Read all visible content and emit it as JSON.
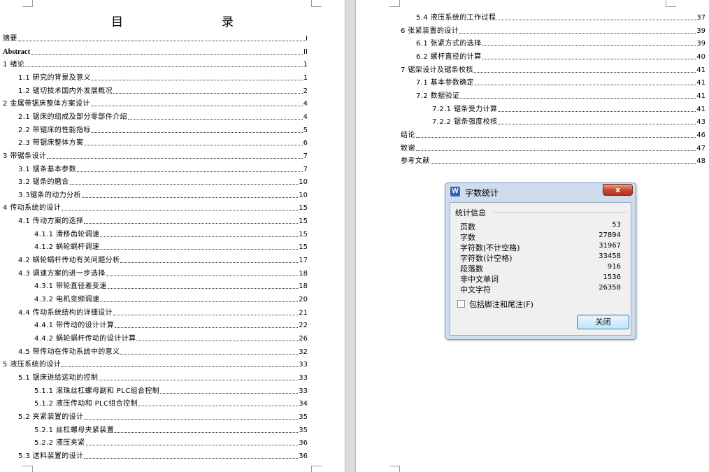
{
  "document": {
    "toc_title": "目　录",
    "entries": [
      {
        "text": "摘要",
        "page": "I",
        "style": "plain"
      },
      {
        "text": "Abstract",
        "page": "II",
        "style": "bold"
      },
      {
        "text": "1 绪论",
        "page": "1",
        "style": "plain"
      },
      {
        "text": "1.1 研究的背景及意义",
        "page": "1",
        "style": "plain"
      },
      {
        "text": "1.2 锯切技术国内外发展概况",
        "page": "2",
        "style": "plain"
      },
      {
        "text": "2 金属带锯床整体方案设计",
        "page": "4",
        "style": "plain"
      },
      {
        "text": "2.1 锯床的组成及部分零部件介绍",
        "page": "4",
        "style": "plain"
      },
      {
        "text": "2.2 带锯床的性能指标",
        "page": "5",
        "style": "plain"
      },
      {
        "text": "2.3 带锯床整体方案",
        "page": "6",
        "style": "plain"
      },
      {
        "text": "3 带锯条设计",
        "page": "7",
        "style": "plain"
      },
      {
        "text": "3.1 锯条基本参数",
        "page": "7",
        "style": "plain"
      },
      {
        "text": "3.2 锯条的磨合",
        "page": "10",
        "style": "plain"
      },
      {
        "text": "3.3锯条的动力分析",
        "page": "10",
        "style": "plain"
      },
      {
        "text": "4 传动系统的设计",
        "page": "15",
        "style": "plain"
      },
      {
        "text": "4.1 传动方案的选择",
        "page": "15",
        "style": "plain"
      },
      {
        "text": "4.1.1 滑移齿轮调速",
        "page": "15",
        "style": "plain"
      },
      {
        "text": "4.1.2 蜗轮蜗杆调速",
        "page": "15",
        "style": "plain"
      },
      {
        "text": "4.2 蜗轮蜗杆传动有关问题分析",
        "page": "17",
        "style": "plain"
      },
      {
        "text": "4.3 调速方案的进一步选择",
        "page": "18",
        "style": "plain"
      },
      {
        "text": "4.3.1 带轮直径差变速",
        "page": "18",
        "style": "plain"
      },
      {
        "text": "4.3.2 电机变频调速",
        "page": "20",
        "style": "plain"
      },
      {
        "text": "4.4 传动系统结构的详细设计",
        "page": "21",
        "style": "plain"
      },
      {
        "text": "4.4.1 带传动的设计计算",
        "page": "22",
        "style": "plain"
      },
      {
        "text": "4.4.2 蜗轮蜗杆传动的设计计算",
        "page": "26",
        "style": "plain"
      },
      {
        "text": "4.5 带传动在传动系统中的意义",
        "page": "32",
        "style": "plain"
      },
      {
        "text": "5 液压系统的设计",
        "page": "33",
        "style": "plain"
      },
      {
        "text": "5.1 锯床进给运动的控制",
        "page": "33",
        "style": "plain"
      },
      {
        "text": "5.1.1 滚珠丝杠螺母副和 PLC组合控制",
        "page": "33",
        "style": "plain"
      },
      {
        "text": "5.1.2 液压传动和 PLC组合控制",
        "page": "34",
        "style": "plain"
      },
      {
        "text": "5.2 夹紧装置的设计",
        "page": "35",
        "style": "plain"
      },
      {
        "text": "5.2.1 丝杠螺母夹紧装置",
        "page": "35",
        "style": "plain"
      },
      {
        "text": "5.2.2 液压夹紧",
        "page": "36",
        "style": "plain"
      },
      {
        "text": "5.3 送料装置的设计",
        "page": "36",
        "style": "plain"
      },
      {
        "text": "5.4 液压系统的工作过程",
        "page": "37",
        "style": "plain"
      },
      {
        "text": "6 张紧装置的设计",
        "page": "39",
        "style": "plain"
      },
      {
        "text": "6.1 张紧方式的选择",
        "page": "39",
        "style": "plain"
      },
      {
        "text": "6.2 螺杆直径的计算",
        "page": "40",
        "style": "plain"
      },
      {
        "text": "7 锯架设计及锯条校核",
        "page": "41",
        "style": "plain"
      },
      {
        "text": "7.1 基本参数确定",
        "page": "41",
        "style": "plain"
      },
      {
        "text": "7.2 数据验证",
        "page": "41",
        "style": "plain"
      },
      {
        "text": "7.2.1 锯条受力计算",
        "page": "41",
        "style": "plain"
      },
      {
        "text": "7.2.2 锯条强度校核",
        "page": "43",
        "style": "plain"
      },
      {
        "text": "结论",
        "page": "46",
        "style": "plain"
      },
      {
        "text": "致谢",
        "page": "47",
        "style": "plain"
      },
      {
        "text": "参考文献",
        "page": "48",
        "style": "plain"
      }
    ]
  },
  "dialog": {
    "app_icon": "W",
    "title": "字数统计",
    "close_symbol": "x",
    "group_label": "统计信息",
    "stats": [
      {
        "label": "页数",
        "value": "53"
      },
      {
        "label": "字数",
        "value": "27894"
      },
      {
        "label": "字符数(不计空格)",
        "value": "31967"
      },
      {
        "label": "字符数(计空格)",
        "value": "33458"
      },
      {
        "label": "段落数",
        "value": "916"
      },
      {
        "label": "非中文单词",
        "value": "1536"
      },
      {
        "label": "中文字符",
        "value": "26358"
      }
    ],
    "checkbox_label": "包括脚注和尾注(F)",
    "checkbox_checked": false,
    "close_button_label": "关闭"
  },
  "colors": {
    "page_gap": "#dcdcdc",
    "dialog_frame": "#cfdcee",
    "close_button_red": "#c6452c",
    "button_blue": "#bee6fd"
  }
}
